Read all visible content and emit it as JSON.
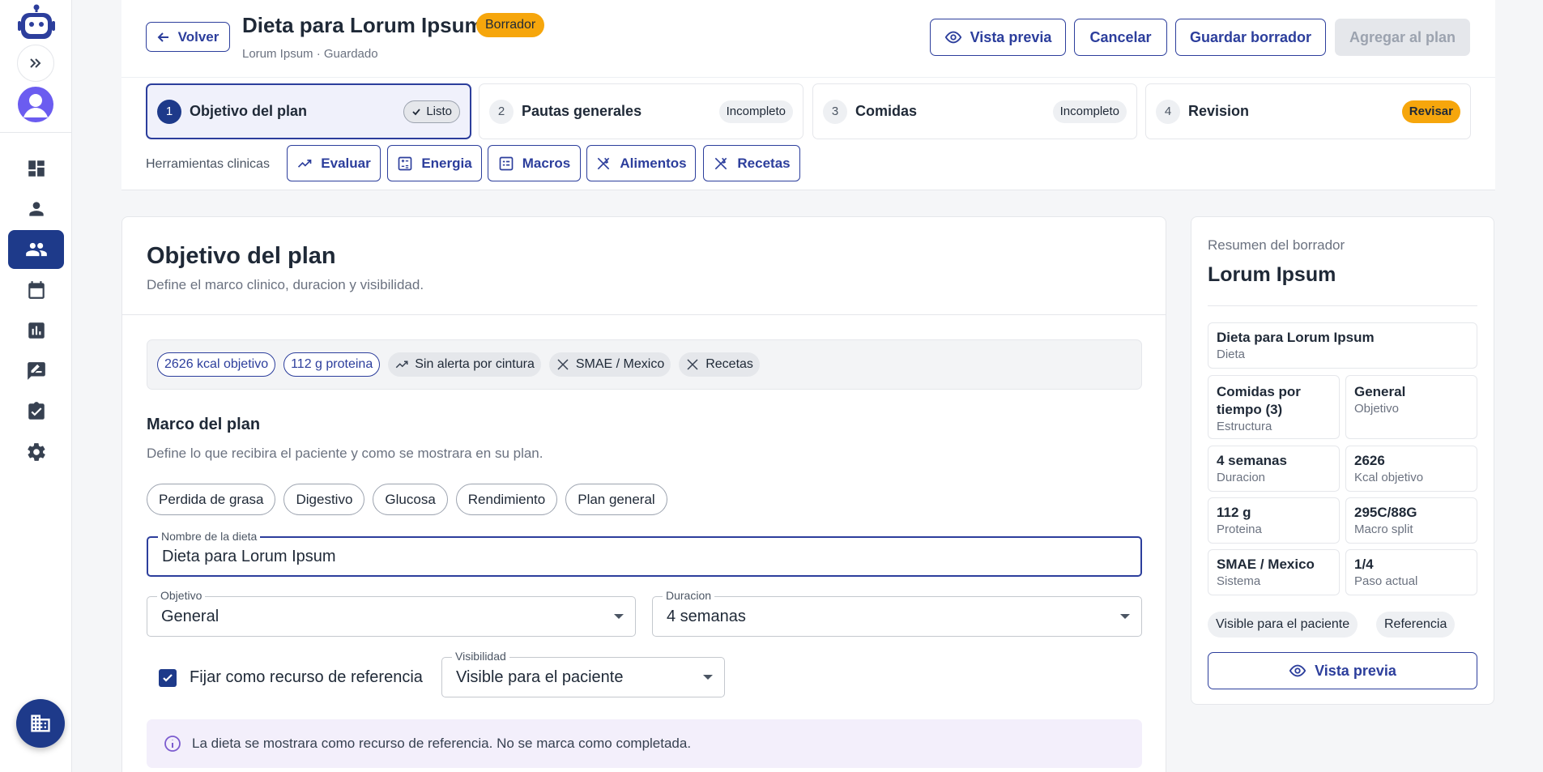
{
  "header": {
    "back_label": "Volver",
    "title": "Dieta para Lorum Ipsum",
    "status_badge": "Borrador",
    "subtitle": "Lorum Ipsum · Guardado",
    "preview_label": "Vista previa",
    "cancel_label": "Cancelar",
    "save_draft_label": "Guardar borrador",
    "add_to_plan_label": "Agregar al plan"
  },
  "steps": [
    {
      "num": "1",
      "label": "Objetivo del plan",
      "status": "Listo"
    },
    {
      "num": "2",
      "label": "Pautas generales",
      "status": "Incompleto"
    },
    {
      "num": "3",
      "label": "Comidas",
      "status": "Incompleto"
    },
    {
      "num": "4",
      "label": "Revision",
      "status": "Revisar"
    }
  ],
  "tools": {
    "label": "Herramientas clinicas",
    "items": [
      "Evaluar",
      "Energia",
      "Macros",
      "Alimentos",
      "Recetas"
    ]
  },
  "main": {
    "title": "Objetivo del plan",
    "subtitle": "Define el marco clinico, duracion y visibilidad.",
    "chips": [
      "2626 kcal objetivo",
      "112 g proteina",
      "Sin alerta por cintura",
      "SMAE / Mexico",
      "Recetas"
    ],
    "section_title": "Marco del plan",
    "section_subtitle": "Define lo que recibira el paciente y como se mostrara en su plan.",
    "goal_pills": [
      "Perdida de grasa",
      "Digestivo",
      "Glucosa",
      "Rendimiento",
      "Plan general"
    ],
    "diet_name": {
      "label": "Nombre de la dieta",
      "value": "Dieta para Lorum Ipsum"
    },
    "objective": {
      "label": "Objetivo",
      "value": "General"
    },
    "duration": {
      "label": "Duracion",
      "value": "4 semanas"
    },
    "pin_reference": {
      "label": "Fijar como recurso de referencia",
      "checked": true
    },
    "visibility": {
      "label": "Visibilidad",
      "value": "Visible para el paciente"
    },
    "info": "La dieta se mostrara como recurso de referencia. No se marca como completada."
  },
  "summary": {
    "kicker": "Resumen del borrador",
    "title": "Lorum Ipsum",
    "diet": {
      "value": "Dieta para Lorum Ipsum",
      "key": "Dieta"
    },
    "items": [
      {
        "value": "Comidas por tiempo (3)",
        "key": "Estructura"
      },
      {
        "value": "General",
        "key": "Objetivo"
      },
      {
        "value": "4 semanas",
        "key": "Duracion"
      },
      {
        "value": "2626",
        "key": "Kcal objetivo"
      },
      {
        "value": "112 g",
        "key": "Proteina"
      },
      {
        "value": "295C/88G",
        "key": "Macro split"
      },
      {
        "value": "SMAE / Mexico",
        "key": "Sistema"
      },
      {
        "value": "1/4",
        "key": "Paso actual"
      }
    ],
    "tags": [
      "Visible para el paciente",
      "Referencia"
    ],
    "preview_label": "Vista previa"
  },
  "colors": {
    "primary": "#1e3a8a",
    "accent_orange": "#f6a60c",
    "info_bg": "#f3effb"
  }
}
